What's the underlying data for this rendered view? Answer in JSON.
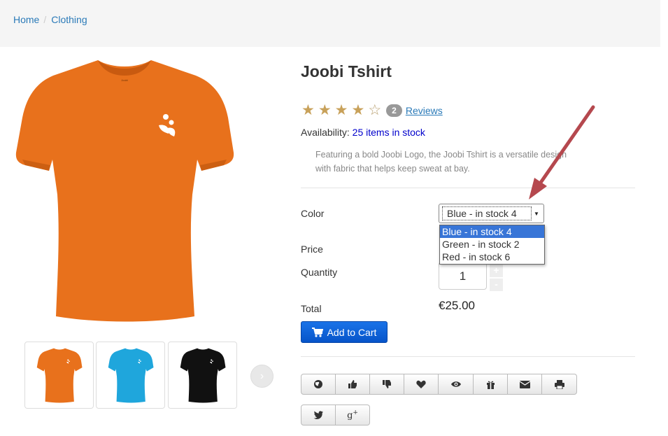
{
  "breadcrumb": {
    "home": "Home",
    "separator": "/",
    "current": "Clothing"
  },
  "product": {
    "title": "Joobi Tshirt",
    "rating": {
      "value": 4,
      "max": 5,
      "review_count": "2",
      "reviews_label": "Reviews"
    },
    "availability_label": "Availability:",
    "availability_value": "25 items in stock",
    "description": "Featuring a bold Joobi Logo, the Joobi Tshirt is a versatile design with fabric that helps keep sweat at bay.",
    "main_image_color": "#e8711c"
  },
  "thumbnails": [
    {
      "color": "#e8711c"
    },
    {
      "color": "#1fa6dc"
    },
    {
      "color": "#111111"
    }
  ],
  "form": {
    "color_label": "Color",
    "color_selected": "Blue - in stock 4",
    "color_options": [
      "Blue - in stock 4",
      "Green - in stock 2",
      "Red - in stock 6"
    ],
    "price_label": "Price",
    "quantity_label": "Quantity",
    "quantity_value": "1",
    "qty_plus": "+",
    "qty_minus": "-",
    "total_label": "Total",
    "total_value": "€25.00",
    "add_to_cart": "Add to Cart"
  },
  "colors": {
    "accent_blue": "#2a7ab8",
    "cart_button": "#0654c9",
    "annotation_arrow": "#b5484e",
    "star": "#c8a15a"
  },
  "action_icons": [
    "globe-icon",
    "thumbs-up-icon",
    "thumbs-down-icon",
    "heart-icon",
    "eye-icon",
    "gift-icon",
    "envelope-icon",
    "print-icon"
  ],
  "share_icons": [
    "twitter-icon",
    "google-plus-icon"
  ]
}
